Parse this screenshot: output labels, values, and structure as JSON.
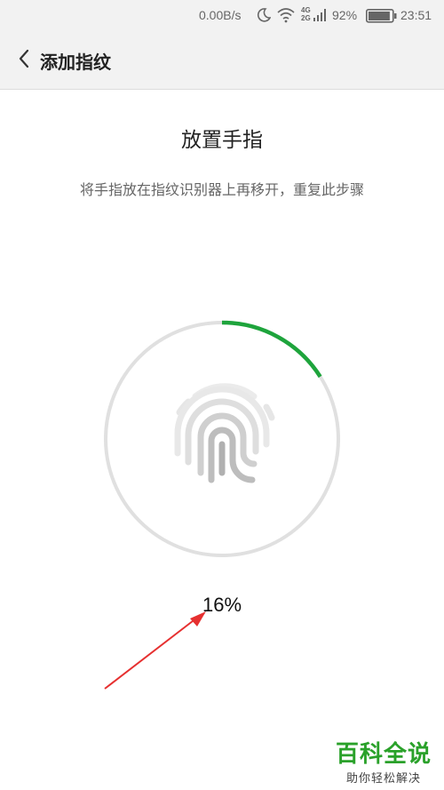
{
  "status_bar": {
    "network_speed": "0.00B/s",
    "moon_icon": "moon-icon",
    "wifi_icon": "wifi-icon",
    "signal_top": "4G",
    "signal_bottom": "2G",
    "battery": "92%",
    "battery_level": 0.92,
    "time": "23:51"
  },
  "header": {
    "back_icon": "chevron-left-icon",
    "title": "添加指纹"
  },
  "main": {
    "title": "放置手指",
    "instruction": "将手指放在指纹识别器上再移开，重复此步骤",
    "progress_percent": 16,
    "progress_label": "16%"
  },
  "watermark": {
    "title": "百科全说",
    "subtitle": "助你轻松解决"
  },
  "colors": {
    "progress": "#1ea43c",
    "ring_track": "#e0e0e0",
    "arrow": "#e63030",
    "watermark_green": "#2aa12a"
  }
}
